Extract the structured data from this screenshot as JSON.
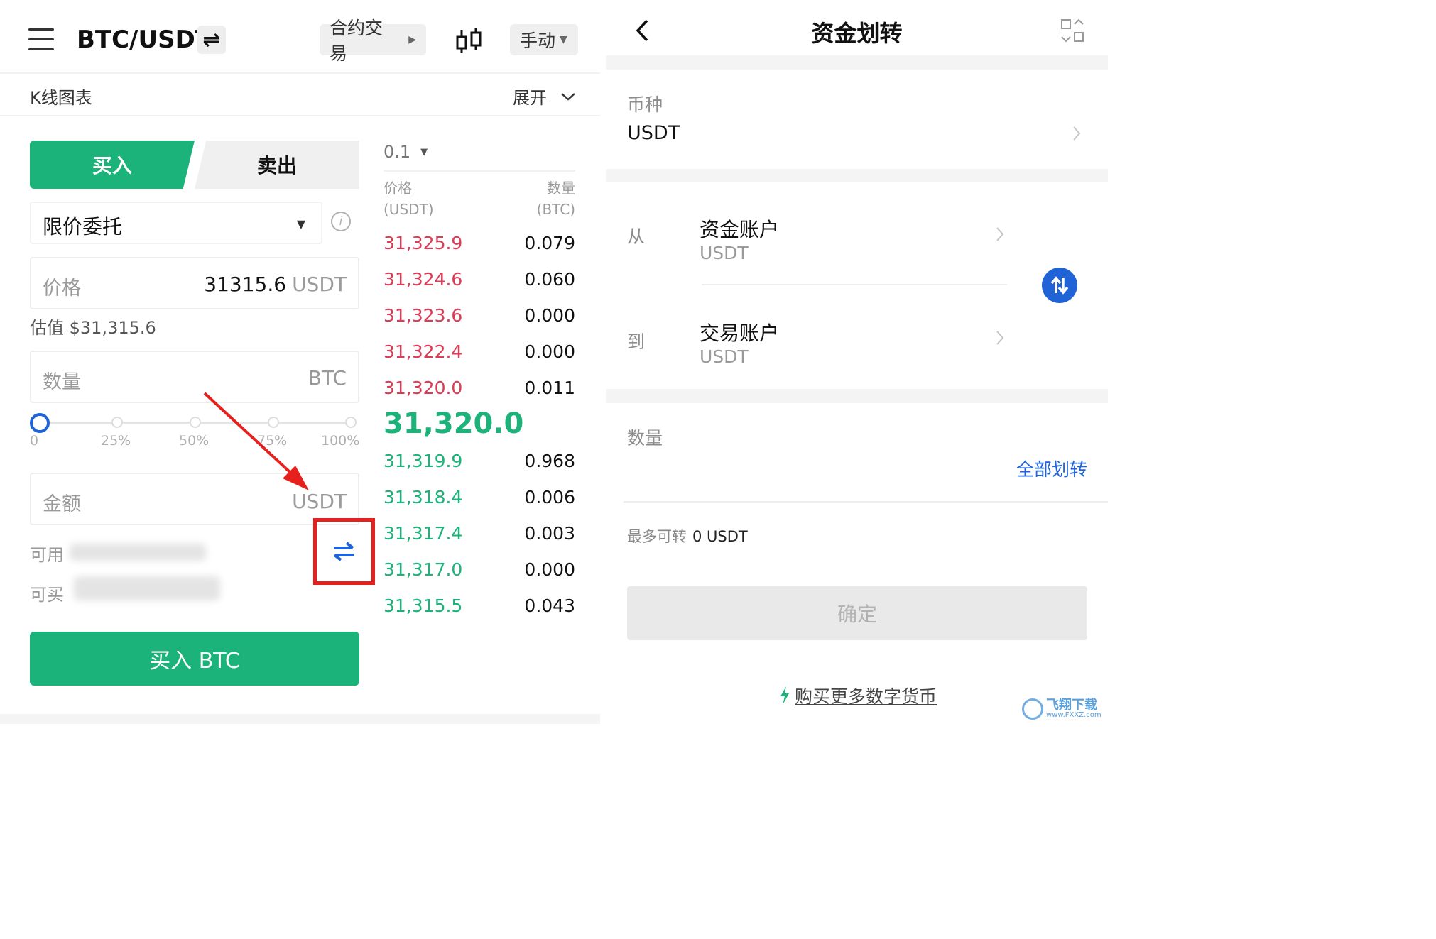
{
  "left": {
    "header": {
      "pair": "BTC/USDT",
      "swap_symbol": "⇌",
      "contract_label": "合约交易",
      "mode_label": "手动",
      "icons": [
        "menu-icon",
        "swap-icon",
        "candlestick-icon",
        "triangle-down-icon"
      ]
    },
    "kline": {
      "label": "K线图表",
      "expand_label": "展开"
    },
    "tabs": {
      "buy": "买入",
      "sell": "卖出"
    },
    "order_type": "限价委托",
    "price": {
      "label": "价格",
      "value": "31315.6",
      "unit": "USDT"
    },
    "estimate": "估值 $31,315.6",
    "quantity": {
      "label": "数量",
      "unit": "BTC"
    },
    "slider": {
      "value_pct": 0,
      "labels": [
        "0",
        "25%",
        "50%",
        "75%",
        "100%"
      ]
    },
    "amount": {
      "label": "金额",
      "unit": "USDT"
    },
    "available_label": "可用",
    "can_buy_label": "可买",
    "buy_button": "买入 BTC",
    "orderbook": {
      "precision": "0.1",
      "price_header": [
        "价格",
        "(USDT)"
      ],
      "qty_header": [
        "数量",
        "(BTC)"
      ],
      "asks": [
        {
          "price": "31,325.9",
          "qty": "0.079"
        },
        {
          "price": "31,324.6",
          "qty": "0.060"
        },
        {
          "price": "31,323.6",
          "qty": "0.000"
        },
        {
          "price": "31,322.4",
          "qty": "0.000"
        },
        {
          "price": "31,320.0",
          "qty": "0.011"
        }
      ],
      "last_price": "31,320.0",
      "bids": [
        {
          "price": "31,319.9",
          "qty": "0.968"
        },
        {
          "price": "31,318.4",
          "qty": "0.006"
        },
        {
          "price": "31,317.4",
          "qty": "0.003"
        },
        {
          "price": "31,317.0",
          "qty": "0.000"
        },
        {
          "price": "31,315.5",
          "qty": "0.043"
        }
      ]
    },
    "colors": {
      "buy_green": "#1bb37a",
      "ask_red": "#dd3b55",
      "highlight_red": "#e6201c",
      "link_blue": "#1f63d6"
    }
  },
  "right": {
    "title": "资金划转",
    "currency_label": "币种",
    "currency_value": "USDT",
    "from_label": "从",
    "from_account": "资金账户",
    "from_currency": "USDT",
    "to_label": "到",
    "to_account": "交易账户",
    "to_currency": "USDT",
    "quantity_label": "数量",
    "transfer_all": "全部划转",
    "max_transfer_label": "最多可转",
    "max_transfer_value": "0 USDT",
    "confirm": "确定",
    "buy_more": "购买更多数字货币",
    "watermark": "飞翔下载 www.FXXZ.com"
  }
}
